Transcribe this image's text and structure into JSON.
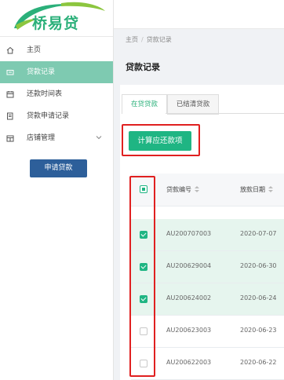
{
  "logo": {
    "text": "桥易贷"
  },
  "sidebar": {
    "items": [
      {
        "label": "主页",
        "icon": "home-icon"
      },
      {
        "label": "贷款记录",
        "icon": "card-icon",
        "active": true
      },
      {
        "label": "还款时间表",
        "icon": "calendar-icon"
      },
      {
        "label": "贷款申请记录",
        "icon": "document-icon"
      },
      {
        "label": "店铺管理",
        "icon": "store-icon"
      }
    ],
    "apply_button": "申请贷款"
  },
  "breadcrumb": {
    "home": "主页",
    "separator": "/",
    "current": "贷款记录"
  },
  "page_title": "贷款记录",
  "tabs": [
    {
      "label": "在贷贷款",
      "active": true
    },
    {
      "label": "已结清贷款",
      "active": false
    }
  ],
  "calc_button": "计算应还款项",
  "table": {
    "headers": {
      "loan_no": "贷款编号",
      "date": "放款日期"
    },
    "rows": [
      {
        "loan_no": "AU200707003",
        "date": "2020-07-07",
        "checked": true
      },
      {
        "loan_no": "AU200629004",
        "date": "2020-06-30",
        "checked": true
      },
      {
        "loan_no": "AU200624002",
        "date": "2020-06-24",
        "checked": true
      },
      {
        "loan_no": "AU200623003",
        "date": "2020-06-23",
        "checked": false
      },
      {
        "loan_no": "AU200622003",
        "date": "2020-06-22",
        "checked": false
      }
    ]
  },
  "colors": {
    "brand": "#2bb07a",
    "active_nav": "#7ecab1",
    "primary_button": "#1fb583",
    "apply_button": "#2d5f9a",
    "highlight_border": "#e02020",
    "selected_row": "#e6f5ee"
  }
}
